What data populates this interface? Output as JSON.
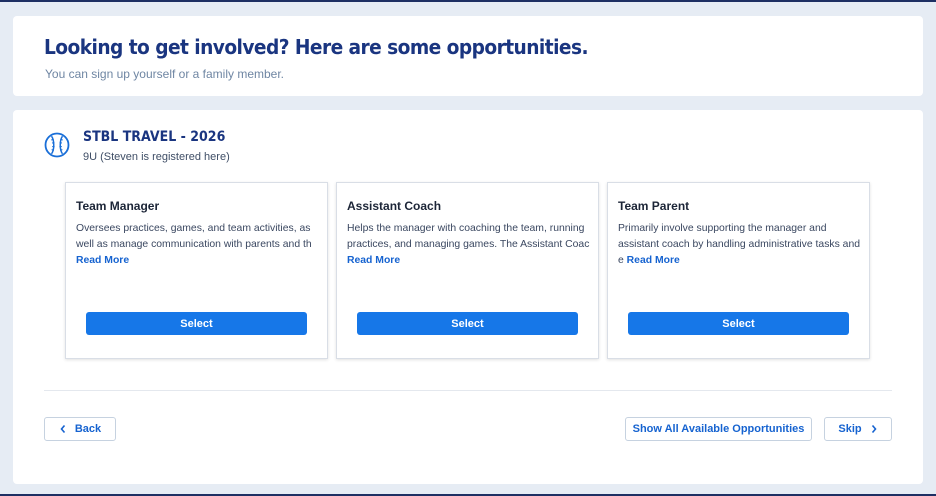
{
  "header": {
    "title": "Looking to get involved? Here are some opportunities.",
    "subtitle": "You can sign up yourself or a family member."
  },
  "program": {
    "icon": "baseball-icon",
    "title": "STBL TRAVEL - 2026",
    "subtitle": "9U (Steven is registered here)"
  },
  "opportunities": [
    {
      "title": "Team Manager",
      "description": "Oversees practices, games, and team activities, as well as manage communication with parents and th",
      "read_more": "Read More",
      "select_label": "Select"
    },
    {
      "title": "Assistant Coach",
      "description": "Helps the manager with coaching the team, running practices, and managing games. The Assistant Coac",
      "read_more": "Read More",
      "select_label": "Select"
    },
    {
      "title": "Team Parent",
      "description": "Primarily involve supporting the manager and assistant coach by handling administrative tasks and e",
      "read_more": "Read More",
      "select_label": "Select"
    }
  ],
  "footer": {
    "back_label": "Back",
    "show_all_label": "Show All Available Opportunities",
    "skip_label": "Skip"
  },
  "colors": {
    "accent": "#1677e8",
    "title": "#1a3580",
    "background": "#e6ecf4"
  }
}
